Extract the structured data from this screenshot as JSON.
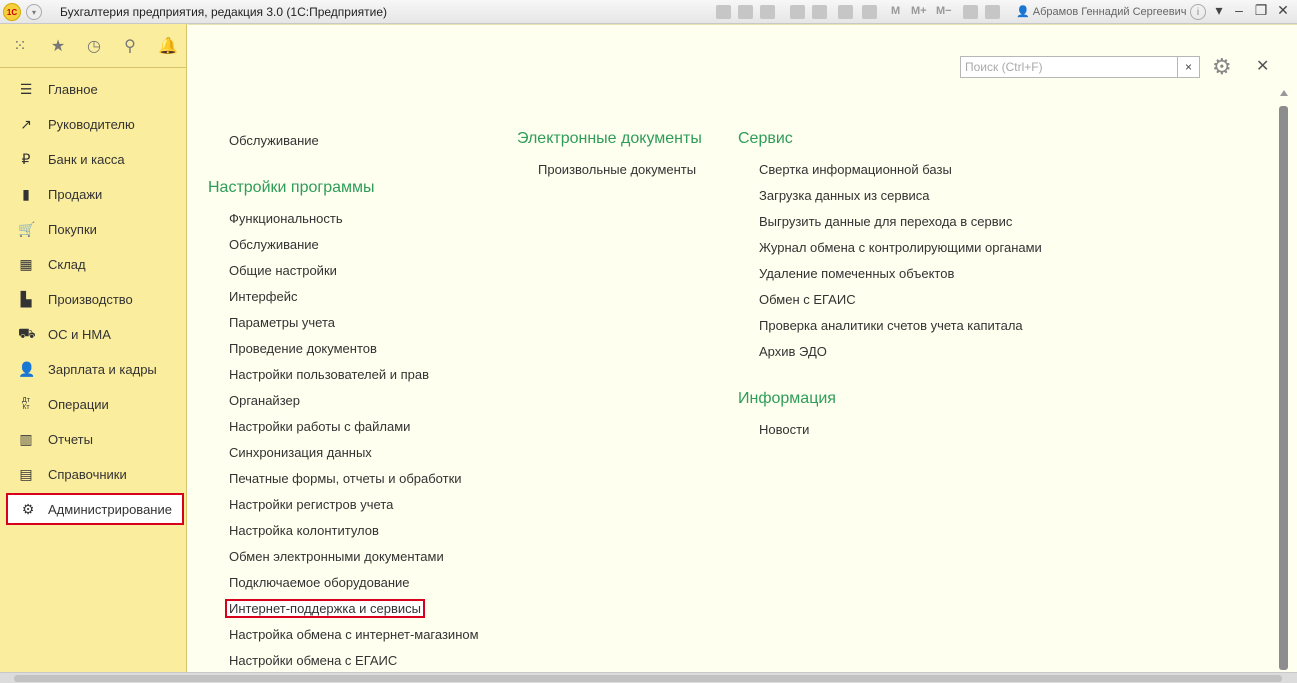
{
  "app": {
    "logo_text": "1С",
    "title": "Бухгалтерия предприятия, редакция 3.0  (1С:Предприятие)",
    "user": "Абрамов Геннадий Сергеевич",
    "toolbar_text": {
      "m": "M",
      "m_plus": "M+",
      "m_minus": "M−"
    }
  },
  "sidebar": {
    "items": [
      {
        "label": "Главное",
        "icon": "menu-lines-icon"
      },
      {
        "label": "Руководителю",
        "icon": "trend-up-icon"
      },
      {
        "label": "Банк и касса",
        "icon": "ruble-coin-icon"
      },
      {
        "label": "Продажи",
        "icon": "shopping-bag-icon"
      },
      {
        "label": "Покупки",
        "icon": "cart-icon"
      },
      {
        "label": "Склад",
        "icon": "warehouse-grid-icon"
      },
      {
        "label": "Производство",
        "icon": "factory-icon"
      },
      {
        "label": "ОС и НМА",
        "icon": "truck-icon"
      },
      {
        "label": "Зарплата и кадры",
        "icon": "person-icon"
      },
      {
        "label": "Операции",
        "icon": "dt-kt-icon",
        "icon_text": "Дт\nКт"
      },
      {
        "label": "Отчеты",
        "icon": "bar-chart-icon"
      },
      {
        "label": "Справочники",
        "icon": "books-icon"
      },
      {
        "label": "Администрирование",
        "icon": "gear-icon",
        "active": true
      }
    ]
  },
  "search": {
    "placeholder": "Поиск (Ctrl+F)",
    "value": ""
  },
  "col1": {
    "top_link": "Обслуживание",
    "section_title": "Настройки программы",
    "links": [
      "Функциональность",
      "Обслуживание",
      "Общие настройки",
      "Интерфейс",
      "Параметры учета",
      "Проведение документов",
      "Настройки пользователей и прав",
      "Органайзер",
      "Настройки работы с файлами",
      "Синхронизация данных",
      "Печатные формы, отчеты и обработки",
      "Настройки регистров учета",
      "Настройка колонтитулов",
      "Обмен электронными документами",
      "Подключаемое оборудование",
      "Интернет-поддержка и сервисы",
      "Настройка обмена с интернет-магазином",
      "Настройки обмена с ЕГАИС"
    ],
    "highlighted_link": "Интернет-поддержка и сервисы"
  },
  "col2": {
    "section_title": "Электронные документы",
    "links": [
      "Произвольные документы"
    ]
  },
  "col3": {
    "service_title": "Сервис",
    "service_links": [
      "Свертка информационной базы",
      "Загрузка данных из сервиса",
      "Выгрузить данные для перехода в сервис",
      "Журнал обмена с контролирующими органами",
      "Удаление помеченных объектов",
      "Обмен с ЕГАИС",
      "Проверка аналитики счетов учета капитала",
      "Архив ЭДО"
    ],
    "info_title": "Информация",
    "info_links": [
      "Новости"
    ]
  },
  "colors": {
    "sidebar_bg": "#fbed9e",
    "content_bg": "#fffff0",
    "section_green": "#2f9d59",
    "highlight_red": "#d9001b"
  }
}
